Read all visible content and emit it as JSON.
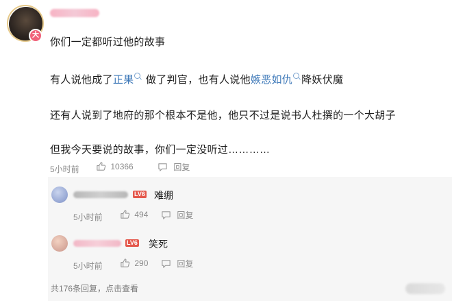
{
  "comment": {
    "body": {
      "line1": "你们一定都听过他的故事",
      "line2_a": "有人说他成了",
      "line2_link1": "正果",
      "line2_b": " 做了判官，也有人说他",
      "line2_link2": "嫉恶如仇",
      "line2_c": "降妖伏魔",
      "line3": "还有人说到了地府的那个根本不是他，他只不过是说书人杜撰的一个大胡子",
      "line4": "但我今天要说的故事，你们一定没听过…………"
    },
    "time": "5小时前",
    "likes": "10366",
    "reply_label": "回复",
    "avatar_badge": "大"
  },
  "replies": [
    {
      "text": "难绷",
      "level": "LV6",
      "time": "5小时前",
      "likes": "494",
      "reply_label": "回复"
    },
    {
      "text": "笑死",
      "level": "LV6",
      "time": "5小时前",
      "likes": "290",
      "reply_label": "回复"
    }
  ],
  "more_replies": "共176条回复，点击查看",
  "colors": {
    "link": "#3d78b8",
    "badge_pink": "#f0627a",
    "level_red": "#e4574b",
    "meta_grey": "#8a8a8a"
  },
  "icons": [
    "thumbs-up-icon",
    "reply-icon",
    "search-icon"
  ]
}
